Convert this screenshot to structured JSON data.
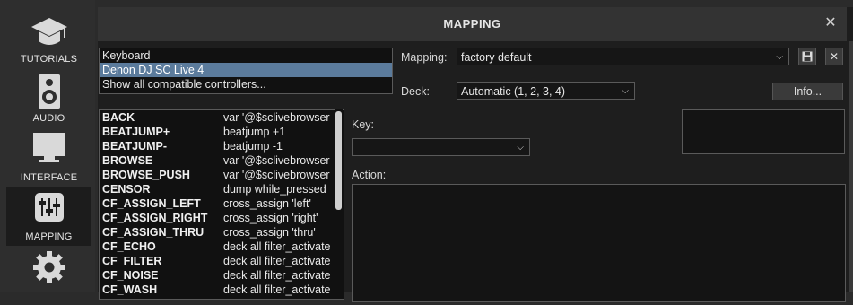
{
  "sidebar": {
    "items": [
      {
        "label": "TUTORIALS",
        "icon": "graduation-cap-icon"
      },
      {
        "label": "AUDIO",
        "icon": "speaker-icon"
      },
      {
        "label": "INTERFACE",
        "icon": "monitor-icon"
      },
      {
        "label": "MAPPING",
        "icon": "sliders-icon",
        "active": true
      },
      {
        "label": "",
        "icon": "gear-icon"
      }
    ]
  },
  "dialog": {
    "title": "MAPPING",
    "close_icon": "close-icon",
    "controllers": [
      "Keyboard",
      "Denon DJ SC Live 4",
      "Show all compatible controllers..."
    ],
    "selected_controller": "Denon DJ SC Live 4",
    "mapping_label": "Mapping:",
    "mapping_value": "factory default",
    "deck_label": "Deck:",
    "deck_value": "Automatic (1, 2, 3, 4)",
    "save_icon": "floppy-disk-icon",
    "delete_icon": "close-icon",
    "info_label": "Info...",
    "key_label": "Key:",
    "key_value": "",
    "action_label": "Action:",
    "commands": [
      {
        "key": "BACK",
        "action": "var '@$sclivebrowser"
      },
      {
        "key": "BEATJUMP+",
        "action": "beatjump +1"
      },
      {
        "key": "BEATJUMP-",
        "action": "beatjump -1"
      },
      {
        "key": "BROWSE",
        "action": "var '@$sclivebrowser"
      },
      {
        "key": "BROWSE_PUSH",
        "action": "var '@$sclivebrowser"
      },
      {
        "key": "CENSOR",
        "action": "dump while_pressed"
      },
      {
        "key": "CF_ASSIGN_LEFT",
        "action": "cross_assign 'left'"
      },
      {
        "key": "CF_ASSIGN_RIGHT",
        "action": "cross_assign 'right'"
      },
      {
        "key": "CF_ASSIGN_THRU",
        "action": "cross_assign 'thru'"
      },
      {
        "key": "CF_ECHO",
        "action": "deck all filter_activate"
      },
      {
        "key": "CF_FILTER",
        "action": "deck all filter_activate"
      },
      {
        "key": "CF_NOISE",
        "action": "deck all filter_activate"
      },
      {
        "key": "CF_WASH",
        "action": "deck all filter_activate"
      }
    ]
  }
}
